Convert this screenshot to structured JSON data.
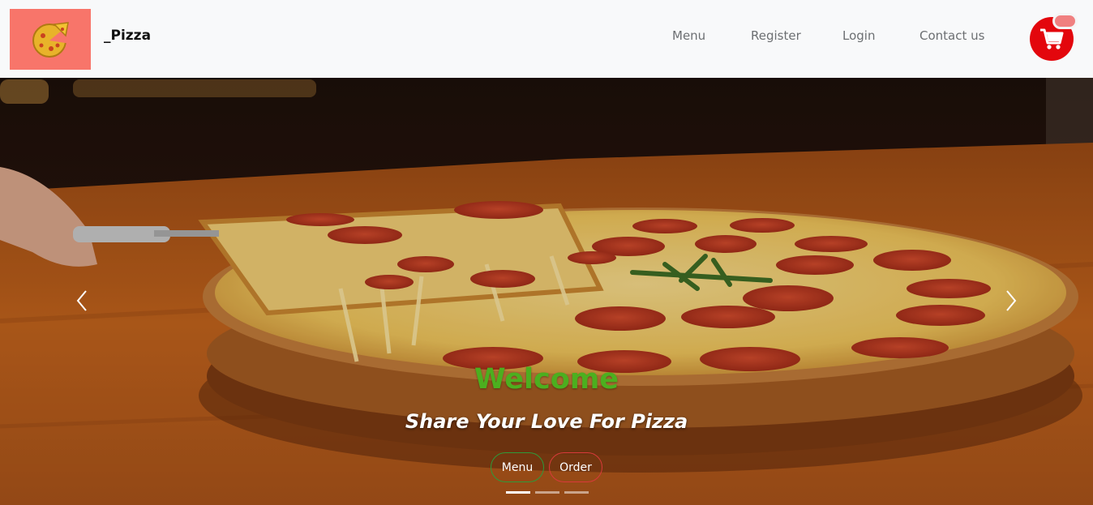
{
  "brand": {
    "name": "_Pizza",
    "logo_icon": "pizza-slice-icon",
    "logo_bg": "#f8756a"
  },
  "nav": {
    "items": [
      {
        "label": "Menu"
      },
      {
        "label": "Register"
      },
      {
        "label": "Login"
      },
      {
        "label": "Contact us"
      }
    ],
    "cart_icon": "shopping-cart-icon",
    "cart_color": "#e3070d"
  },
  "hero": {
    "background_icon": "pizza-photo",
    "title": "Welcome",
    "subtitle": "Share Your Love For Pizza",
    "buttons": {
      "menu": "Menu",
      "order": "Order"
    },
    "prev_icon": "chevron-left-icon",
    "next_icon": "chevron-right-icon",
    "slides": 3,
    "active_slide": 1,
    "colors": {
      "title": "#4caf1f",
      "menu_btn_border": "#2e9a3a",
      "order_btn_border": "#d83a3a"
    }
  }
}
